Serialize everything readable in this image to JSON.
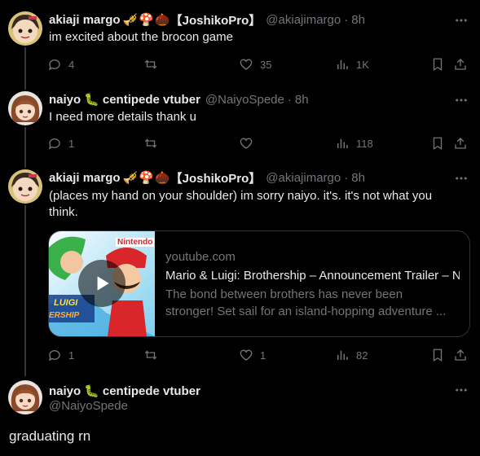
{
  "tweets": [
    {
      "name": "akiaji margo",
      "emoji": [
        "🎺",
        "🍄",
        "🌰"
      ],
      "tag": "【JoshikoPro】",
      "handle": "@akiajimargo",
      "time": "8h",
      "text": "im excited about the brocon game",
      "replies": "4",
      "retweets": "",
      "likes": "35",
      "views": "1K"
    },
    {
      "name": "naiyo",
      "emoji": [
        "🐛"
      ],
      "suffix": "centipede vtuber",
      "handle": "@NaiyoSpede",
      "time": "8h",
      "text": "I need more details thank u",
      "replies": "1",
      "retweets": "",
      "likes": "",
      "views": "118"
    },
    {
      "name": "akiaji margo",
      "emoji": [
        "🎺",
        "🍄",
        "🌰"
      ],
      "tag": "【JoshikoPro】",
      "handle": "@akiajimargo",
      "time": "8h",
      "text_line1": "(places my hand on your shoulder) im sorry naiyo. it's. it's not what you",
      "text_line2": "think.",
      "replies": "1",
      "retweets": "",
      "likes": "1",
      "views": "82",
      "card": {
        "domain": "youtube.com",
        "title": "Mario & Luigi: Brothership – Announcement Trailer – N",
        "desc_line1": "The bond between brothers has never been",
        "desc_line2": "stronger! Set sail for an island-hopping adventure ...",
        "thumb_text_top": "Nintendo",
        "thumb_text_logo1": "LUIGI",
        "thumb_text_logo2": "ERSHIP"
      }
    }
  ],
  "main": {
    "name": "naiyo",
    "emoji": [
      "🐛"
    ],
    "suffix": "centipede vtuber",
    "handle": "@NaiyoSpede",
    "text": "graduating rn"
  },
  "colors": {
    "background": "#000000",
    "text": "#e7e9ea",
    "muted": "#71767b",
    "border": "#2f3336"
  }
}
